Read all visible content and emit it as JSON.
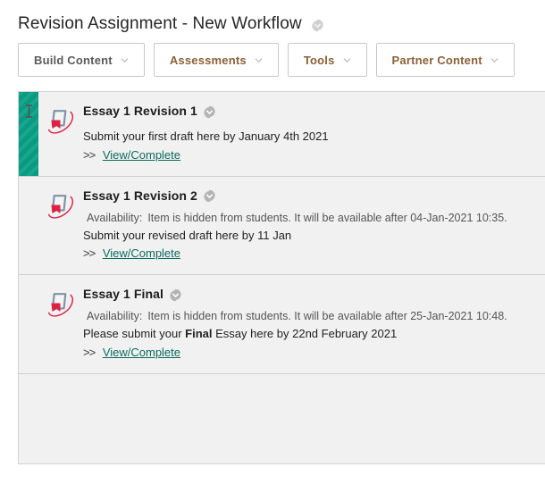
{
  "header": {
    "title": "Revision Assignment - New Workflow",
    "menu_icon": "chevron-down-badge-icon"
  },
  "toolbar": {
    "buttons": [
      {
        "label": "Build Content",
        "style": "grey",
        "caret": "chevron-down-icon"
      },
      {
        "label": "Assessments",
        "style": "brown",
        "caret": "chevron-down-icon"
      },
      {
        "label": "Tools",
        "style": "brown",
        "caret": "chevron-down-icon"
      },
      {
        "label": "Partner Content",
        "style": "brown",
        "caret": "chevron-down-icon"
      }
    ]
  },
  "content": {
    "items": [
      {
        "title": "Essay 1 Revision 1",
        "icon": "assignment-icon",
        "menu_icon": "chevron-down-badge-icon",
        "selected": true,
        "availability_label": "",
        "availability_text": "",
        "description_prefix": "Submit your first draft here by January 4th 2021",
        "description_bold": "",
        "description_suffix": "",
        "chevrons": ">>",
        "link_label": "View/Complete"
      },
      {
        "title": "Essay 1 Revision 2",
        "icon": "assignment-icon",
        "menu_icon": "chevron-down-badge-icon",
        "selected": false,
        "availability_label": "Availability:",
        "availability_text": "Item is hidden from students. It will be available after 04-Jan-2021 10:35.",
        "description_prefix": "Submit your revised draft here by 11 Jan",
        "description_bold": "",
        "description_suffix": "",
        "chevrons": ">>",
        "link_label": "View/Complete"
      },
      {
        "title": "Essay 1 Final",
        "icon": "assignment-icon",
        "menu_icon": "chevron-down-badge-icon",
        "selected": false,
        "availability_label": "Availability:",
        "availability_text": "Item is hidden from students. It will be available after 25-Jan-2021 10:48.",
        "description_prefix": "Please submit your ",
        "description_bold": "Final",
        "description_suffix": " Essay here by 22nd February 2021",
        "chevrons": ">>",
        "link_label": "View/Complete"
      }
    ]
  },
  "colors": {
    "accent_teal": "#059c82",
    "link_teal": "#0b6b5e",
    "brown_label": "#8a6137",
    "grey_label": "#5a5a5a",
    "panel_bg": "#f1f1f1",
    "icon_page": "#7d93a8",
    "icon_swoosh": "#d6294a"
  }
}
